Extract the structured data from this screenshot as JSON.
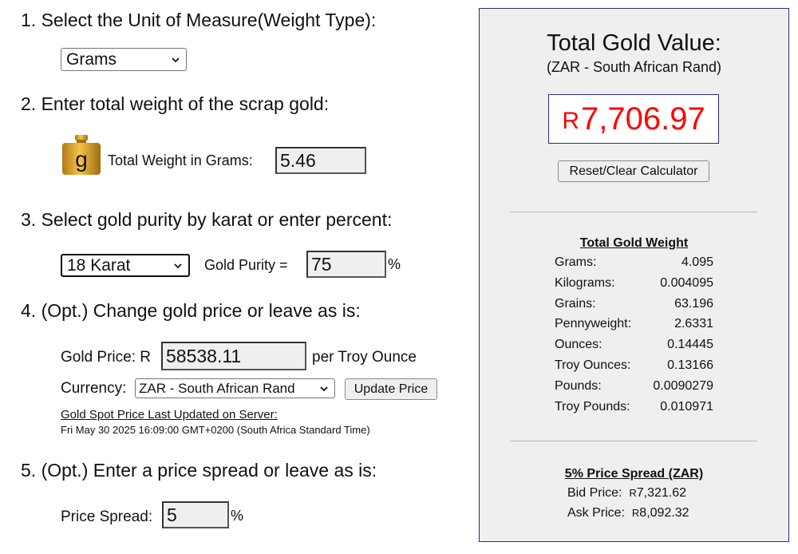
{
  "steps": {
    "s1": "1. Select the Unit of Measure(Weight Type):",
    "s2": "2. Enter total weight of the scrap gold:",
    "s3": "3. Select gold purity by karat or enter percent:",
    "s4": "4. (Opt.) Change gold price or leave as is:",
    "s5": "5. (Opt.) Enter a price spread or leave as is:"
  },
  "unit_select": {
    "value": "Grams"
  },
  "weight": {
    "icon_letter": "g",
    "label": "Total Weight in Grams:",
    "value": "5.46"
  },
  "purity": {
    "karat_value": "18 Karat",
    "label": "Gold Purity =",
    "value": "75",
    "unit": "%"
  },
  "price": {
    "label": "Gold Price: R",
    "value": "58538.11",
    "suffix": "per Troy Ounce",
    "currency_label": "Currency:",
    "currency_value": "ZAR - South African Rand",
    "update_button": "Update Price",
    "updated_label": "Gold Spot Price Last Updated on Server:",
    "updated_time": "Fri May 30 2025 16:09:00 GMT+0200 (South Africa Standard Time)"
  },
  "spread": {
    "label": "Price Spread:",
    "value": "5",
    "unit": "%"
  },
  "panel": {
    "title": "Total Gold Value:",
    "subtitle": "(ZAR - South African Rand)",
    "value_symbol": "R",
    "value_amount": "7,706.97",
    "reset_button": "Reset/Clear Calculator",
    "weight_title": "Total Gold Weight",
    "weights": [
      {
        "label": "Grams:",
        "value": "4.095"
      },
      {
        "label": "Kilograms:",
        "value": "0.004095"
      },
      {
        "label": "Grains:",
        "value": "63.196"
      },
      {
        "label": "Pennyweight:",
        "value": "2.6331"
      },
      {
        "label": "Ounces:",
        "value": "0.14445"
      },
      {
        "label": "Troy Ounces:",
        "value": "0.13166"
      },
      {
        "label": "Pounds:",
        "value": "0.0090279"
      },
      {
        "label": "Troy Pounds:",
        "value": "0.010971"
      }
    ],
    "spread_title": "5% Price Spread (ZAR)",
    "bid_label": "Bid Price:",
    "bid_symbol": "R",
    "bid_value": "7,321.62",
    "ask_label": "Ask Price:",
    "ask_symbol": "R",
    "ask_value": "8,092.32"
  },
  "colors": {
    "value_red": "#ff0000",
    "panel_border": "#2a2a8a",
    "gold": "#d9a21e"
  }
}
